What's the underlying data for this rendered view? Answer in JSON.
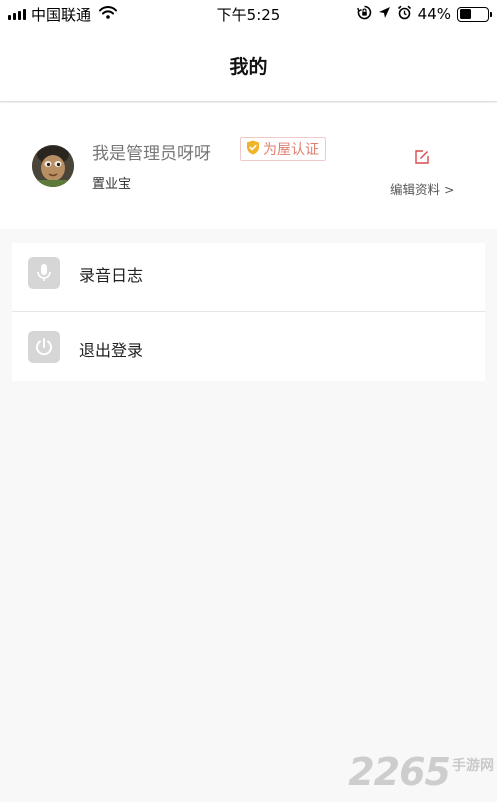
{
  "status_bar": {
    "carrier": "中国联通",
    "time": "下午5:25",
    "battery_text": "44%",
    "battery_level": 0.44,
    "icons": [
      "signal-icon",
      "wifi-icon",
      "orientation-lock-icon",
      "location-icon",
      "alarm-icon",
      "battery-icon"
    ]
  },
  "header": {
    "title": "我的"
  },
  "profile": {
    "name": "我是管理员呀呀",
    "badge": "为屋认证",
    "role": "置业宝",
    "edit_label": "编辑资料 >"
  },
  "menu": {
    "items": [
      {
        "label": "录音日志",
        "icon": "microphone-icon"
      },
      {
        "label": "退出登录",
        "icon": "power-icon"
      }
    ]
  },
  "watermark": {
    "number": "2265",
    "text": "手游网"
  },
  "colors": {
    "badge_text": "#e07f72",
    "badge_border": "#f2c9c9",
    "badge_shield": "#f0b429",
    "edit_icon": "#d94a4a",
    "menu_icon_bg": "#d6d6d6",
    "page_bg": "#f8f8f8"
  }
}
